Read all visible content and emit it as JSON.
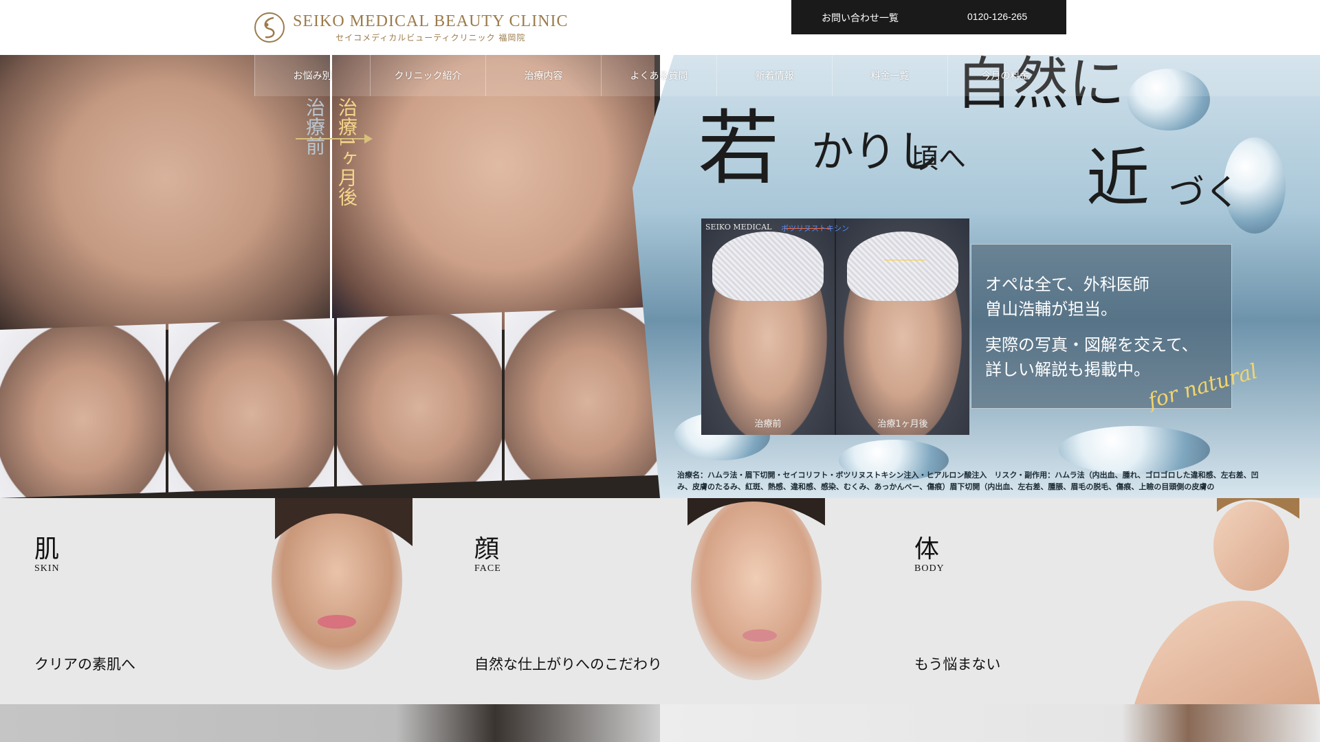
{
  "header": {
    "logo_en": "SEIKO MEDICAL BEAUTY CLINIC",
    "logo_jp": "セイコメディカルビューティクリニック 福岡院",
    "contact_label": "お問い合わせ一覧",
    "phone": "0120-126-265"
  },
  "nav": {
    "items": [
      {
        "label": "お悩み別"
      },
      {
        "label": "クリニック紹介"
      },
      {
        "label": "治療内容"
      },
      {
        "label": "よくある質問"
      },
      {
        "label": "新着情報"
      },
      {
        "label": "料金一覧"
      },
      {
        "label": "今月の料金"
      }
    ]
  },
  "hero": {
    "before_label": "治療前",
    "after_label": "治療1ヶ月後",
    "headline": {
      "part1": "自然に",
      "part2": "若",
      "part3": "かりし",
      "part4": "頃へ",
      "part5": "近",
      "part6": "づく"
    },
    "compare": {
      "brand": "SEIKO MEDICAL",
      "annotation": "ボツリヌストキシン",
      "before": "治療前",
      "after": "治療1ヶ月後"
    },
    "info": {
      "line1": "オペは全て、外科医師",
      "line2": "曽山浩輔が担当。",
      "line3": "実際の写真・図解を交えて、",
      "line4": "詳しい解説も掲載中。"
    },
    "script_text": "for natural",
    "caption": "治療名：ハムラ法・眉下切開・セイコリフト・ボツリヌストキシン注入・ヒアルロン酸注入　リスク・副作用：ハムラ法（内出血、腫れ、ゴロゴロした違和感、左右差、凹み、皮膚のたるみ、紅斑、熱感、違和感、感染、むくみ、あっかんべー、傷痕）眉下切開（内出血、左右差、腫脹、眉毛の脱毛、傷痕、上瞼の目頭側の皮膚の"
  },
  "categories": [
    {
      "kanji": "肌",
      "en": "SKIN",
      "tagline": "クリアの素肌へ"
    },
    {
      "kanji": "顔",
      "en": "FACE",
      "tagline": "自然な仕上がりへのこだわり"
    },
    {
      "kanji": "体",
      "en": "BODY",
      "tagline": "もう悩まない"
    }
  ],
  "colors": {
    "brand_gold": "#9b7b4b",
    "contact_bg": "#1a1a1a",
    "panel_bg": "#e8e8e8"
  }
}
